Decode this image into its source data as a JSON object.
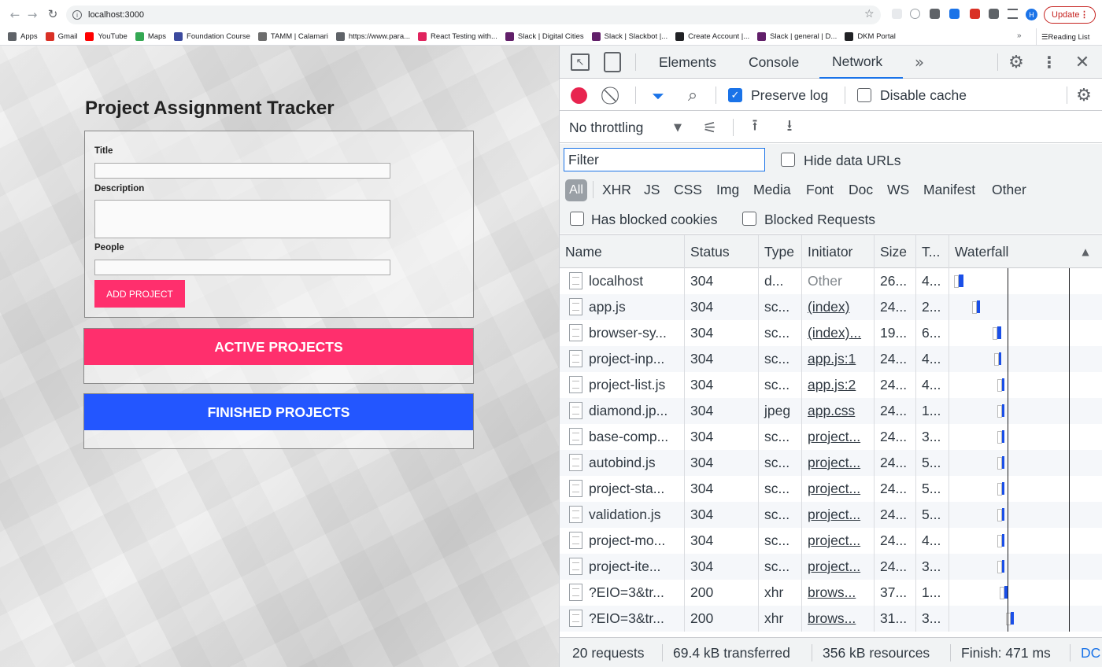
{
  "browser": {
    "url": "localhost:3000",
    "update_label": "Update",
    "profile_initial": "H",
    "bookmarks": [
      {
        "label": "Apps",
        "color": "#5f6368"
      },
      {
        "label": "Gmail",
        "color": "#d93025"
      },
      {
        "label": "YouTube",
        "color": "#ff0000"
      },
      {
        "label": "Maps",
        "color": "#34a853"
      },
      {
        "label": "Foundation Course",
        "color": "#3c4a9e"
      },
      {
        "label": "TAMM | Calamari",
        "color": "#6d6d6d"
      },
      {
        "label": "https://www.para...",
        "color": "#5f6368"
      },
      {
        "label": "React Testing with...",
        "color": "#e0245e"
      },
      {
        "label": "Slack | Digital Cities",
        "color": "#611f69"
      },
      {
        "label": "Slack | Slackbot |...",
        "color": "#611f69"
      },
      {
        "label": "Create Account |...",
        "color": "#202124"
      },
      {
        "label": "Slack | general | D...",
        "color": "#611f69"
      },
      {
        "label": "DKM Portal",
        "color": "#202124"
      }
    ],
    "overflow": "»",
    "reading_list": "Reading List"
  },
  "page": {
    "title": "Project Assignment Tracker",
    "form": {
      "title_label": "Title",
      "description_label": "Description",
      "people_label": "People",
      "submit_label": "ADD PROJECT"
    },
    "active_heading": "ACTIVE PROJECTS",
    "finished_heading": "FINISHED PROJECTS",
    "colors": {
      "active": "#ff2f6d",
      "finished": "#2356ff",
      "button": "#ff2f6d"
    }
  },
  "devtools": {
    "tabs": [
      {
        "label": "Elements",
        "active": false
      },
      {
        "label": "Console",
        "active": false
      },
      {
        "label": "Network",
        "active": true
      }
    ],
    "more_tabs": "»",
    "preserve_log": {
      "label": "Preserve log",
      "checked": true
    },
    "disable_cache": {
      "label": "Disable cache",
      "checked": false
    },
    "throttling": "No throttling",
    "filter_placeholder": "Filter",
    "hide_data_urls": "Hide data URLs",
    "type_filters": [
      "All",
      "XHR",
      "JS",
      "CSS",
      "Img",
      "Media",
      "Font",
      "Doc",
      "WS",
      "Manifest",
      "Other"
    ],
    "has_blocked_cookies": "Has blocked cookies",
    "blocked_requests": "Blocked Requests",
    "columns": [
      "Name",
      "Status",
      "Type",
      "Initiator",
      "Size",
      "T...",
      "Waterfall"
    ],
    "requests": [
      {
        "name": "localhost",
        "status": "304",
        "type": "d...",
        "initiator": "Other",
        "size": "26...",
        "time": "4...",
        "wf_start": 0.02,
        "wf_len": 0.03,
        "link": false
      },
      {
        "name": "app.js",
        "status": "304",
        "type": "sc...",
        "initiator": "(index)",
        "size": "24...",
        "time": "2...",
        "wf_start": 0.14,
        "wf_len": 0.02,
        "link": true
      },
      {
        "name": "browser-sy...",
        "status": "304",
        "type": "sc...",
        "initiator": "(index)...",
        "size": "19...",
        "time": "6...",
        "wf_start": 0.27,
        "wf_len": 0.03,
        "link": true
      },
      {
        "name": "project-inp...",
        "status": "304",
        "type": "sc...",
        "initiator": "app.js:1",
        "size": "24...",
        "time": "4...",
        "wf_start": 0.28,
        "wf_len": 0.02,
        "link": true
      },
      {
        "name": "project-list.js",
        "status": "304",
        "type": "sc...",
        "initiator": "app.js:2",
        "size": "24...",
        "time": "4...",
        "wf_start": 0.3,
        "wf_len": 0.02,
        "link": true
      },
      {
        "name": "diamond.jp...",
        "status": "304",
        "type": "jpeg",
        "initiator": "app.css",
        "size": "24...",
        "time": "1...",
        "wf_start": 0.3,
        "wf_len": 0.01,
        "link": true
      },
      {
        "name": "base-comp...",
        "status": "304",
        "type": "sc...",
        "initiator": "project...",
        "size": "24...",
        "time": "3...",
        "wf_start": 0.3,
        "wf_len": 0.02,
        "link": true
      },
      {
        "name": "autobind.js",
        "status": "304",
        "type": "sc...",
        "initiator": "project...",
        "size": "24...",
        "time": "5...",
        "wf_start": 0.3,
        "wf_len": 0.02,
        "link": true
      },
      {
        "name": "project-sta...",
        "status": "304",
        "type": "sc...",
        "initiator": "project...",
        "size": "24...",
        "time": "5...",
        "wf_start": 0.3,
        "wf_len": 0.02,
        "link": true
      },
      {
        "name": "validation.js",
        "status": "304",
        "type": "sc...",
        "initiator": "project...",
        "size": "24...",
        "time": "5...",
        "wf_start": 0.3,
        "wf_len": 0.02,
        "link": true
      },
      {
        "name": "project-mo...",
        "status": "304",
        "type": "sc...",
        "initiator": "project...",
        "size": "24...",
        "time": "4...",
        "wf_start": 0.3,
        "wf_len": 0.02,
        "link": true
      },
      {
        "name": "project-ite...",
        "status": "304",
        "type": "sc...",
        "initiator": "project...",
        "size": "24...",
        "time": "3...",
        "wf_start": 0.3,
        "wf_len": 0.02,
        "link": true
      },
      {
        "name": "?EIO=3&tr...",
        "status": "200",
        "type": "xhr",
        "initiator": "brows...",
        "size": "37...",
        "time": "1...",
        "wf_start": 0.32,
        "wf_len": 0.02,
        "link": true
      },
      {
        "name": "?EIO=3&tr...",
        "status": "200",
        "type": "xhr",
        "initiator": "brows...",
        "size": "31...",
        "time": "3...",
        "wf_start": 0.36,
        "wf_len": 0.02,
        "link": true
      }
    ],
    "status": {
      "requests": "20 requests",
      "transferred": "69.4 kB transferred",
      "resources": "356 kB resources",
      "finish": "Finish: 471 ms",
      "dcl": "DC"
    }
  }
}
